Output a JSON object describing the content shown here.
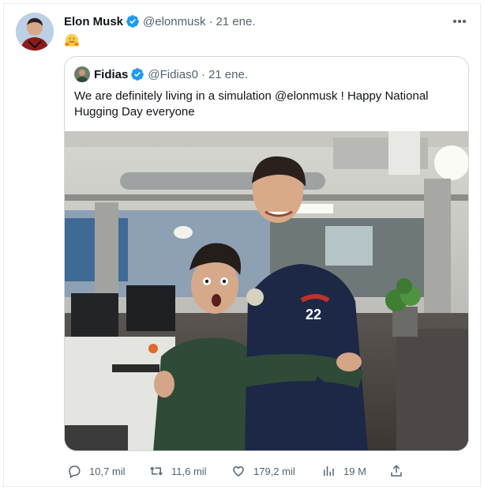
{
  "tweet": {
    "author_name": "Elon Musk",
    "handle": "@elonmusk",
    "separator": "·",
    "date": "21 ene.",
    "body_emoji": "🤗"
  },
  "quote": {
    "author_name": "Fidias",
    "handle": "@Fidias0",
    "separator": "·",
    "date": "21 ene.",
    "text": "We are definitely living in a simulation @elonmusk ! Happy National Hugging Day everyone"
  },
  "actions": {
    "replies": "10,7 mil",
    "retweets": "11,6 mil",
    "likes": "179,2 mil",
    "views": "19 M"
  },
  "icons": {
    "more": "more-options-icon",
    "reply": "reply-icon",
    "retweet": "retweet-icon",
    "like": "heart-icon",
    "views": "views-chart-icon",
    "share": "share-icon",
    "verified": "verified-badge-icon"
  },
  "colors": {
    "verified_blue": "#1d9bf0",
    "secondary_text": "#536471",
    "border": "#cfd9de"
  }
}
